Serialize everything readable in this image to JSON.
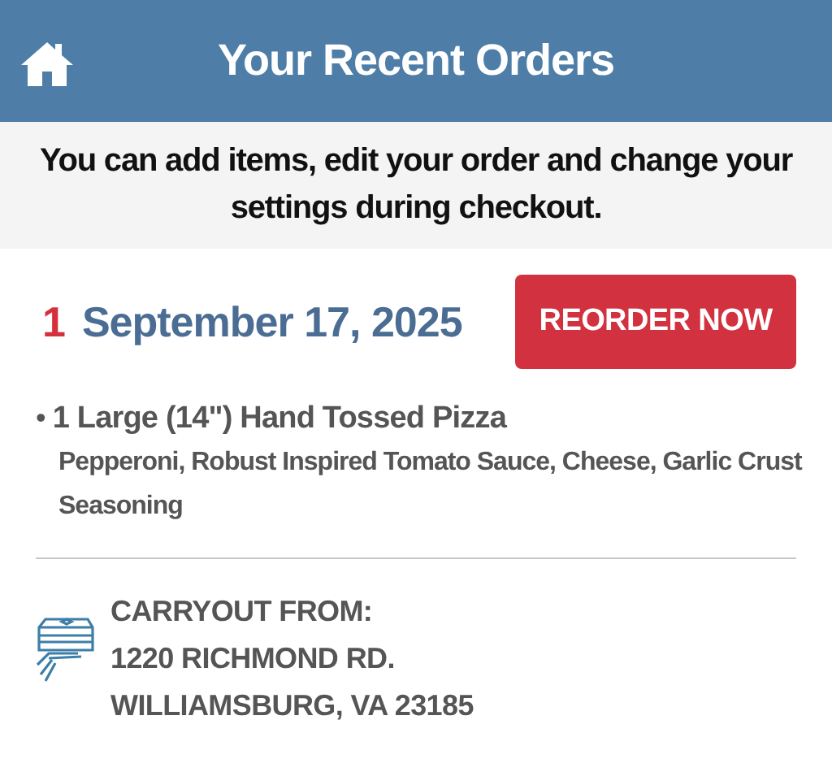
{
  "header": {
    "title": "Your Recent Orders"
  },
  "notice": "You can add items, edit your order and change your settings during checkout.",
  "orders": [
    {
      "number": "1",
      "date": "September 17, 2025",
      "reorder_button": "REORDER NOW",
      "items": [
        {
          "bullet": "•",
          "name": "1 Large (14\") Hand Tossed Pizza",
          "details": "Pepperoni, Robust Inspired Tomato Sauce, Cheese, Garlic Crust Seasoning"
        }
      ],
      "fulfillment": {
        "kind": "carryout",
        "label": "CARRYOUT FROM:",
        "address_lines": [
          "1220 RICHMOND RD.",
          "WILLIAMSBURG, VA 23185"
        ]
      }
    }
  ]
}
